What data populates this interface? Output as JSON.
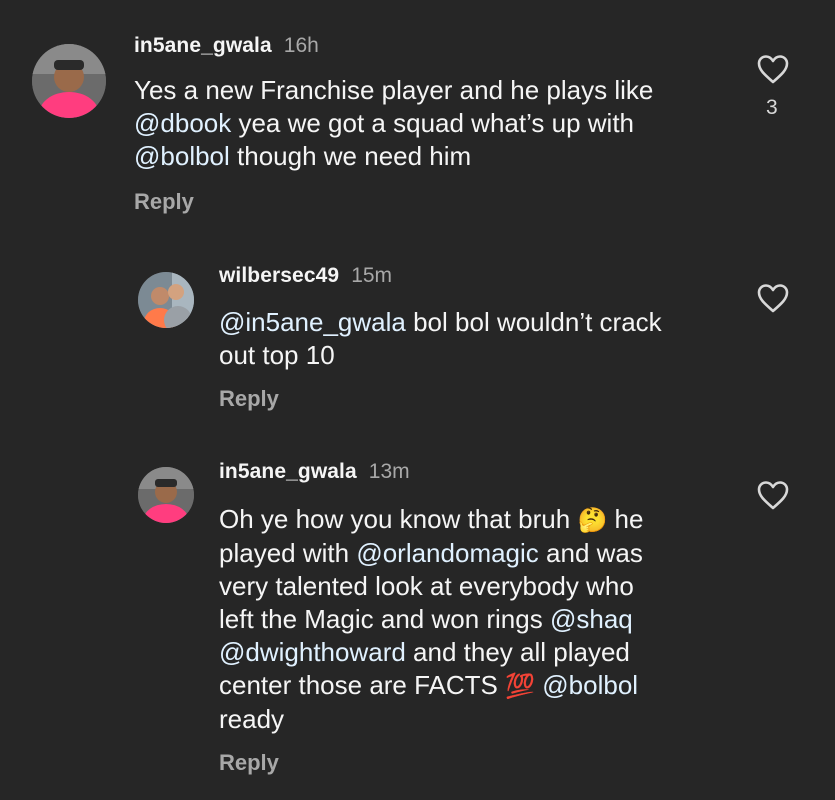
{
  "comments": [
    {
      "username": "in5ane_gwala",
      "time": "16h",
      "lines": [
        [
          "Yes a new Franchise player and he plays like"
        ],
        [
          "@dbook",
          " yea we got a squad what’s up with"
        ],
        [
          "@bolbol",
          " though we need him"
        ]
      ],
      "reply_label": "Reply",
      "likes": "3"
    },
    {
      "username": "wilbersec49",
      "time": "15m",
      "lines": [
        [
          "@in5ane_gwala",
          " bol bol wouldn’t crack"
        ],
        [
          "out top 10"
        ]
      ],
      "reply_label": "Reply"
    },
    {
      "username": "in5ane_gwala",
      "time": "13m",
      "lines": [
        [
          "Oh ye how you know that bruh ",
          "🤔",
          " he"
        ],
        [
          "played with ",
          "@orlandomagic",
          " and was"
        ],
        [
          "very talented look at everybody who"
        ],
        [
          "left the Magic and won rings ",
          "@shaq"
        ],
        [
          "@dwighthoward",
          " and they all played"
        ],
        [
          "center those are FACTS ",
          "💯",
          " ",
          "@bolbol"
        ],
        [
          "ready"
        ]
      ],
      "reply_label": "Reply"
    }
  ],
  "icons": {
    "heart": "heart-outline-icon"
  },
  "colors": {
    "background": "#262626",
    "text": "#f5f5f5",
    "muted": "#a8a8a8",
    "mention": "#e0f1ff"
  }
}
